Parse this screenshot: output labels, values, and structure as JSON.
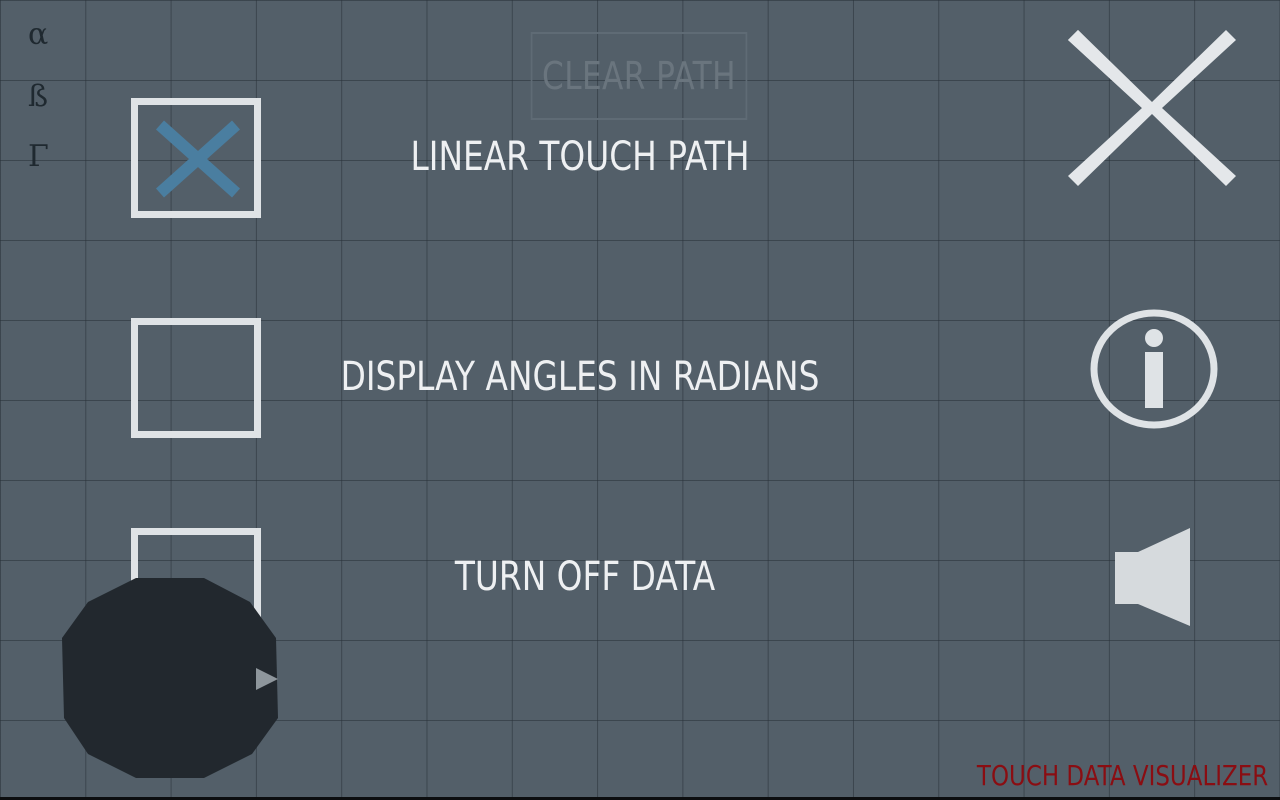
{
  "symbols": {
    "alpha": "α",
    "beta": "ß",
    "gamma": "Γ"
  },
  "clear_path": {
    "label": "CLEAR PATH"
  },
  "options": [
    {
      "label": "LINEAR TOUCH PATH",
      "checked": true
    },
    {
      "label": "DISPLAY ANGLES IN RADIANS",
      "checked": false
    },
    {
      "label": "TURN OFF DATA",
      "checked": false
    }
  ],
  "right_icons": [
    "close-icon",
    "info-icon",
    "speaker-icon"
  ],
  "app_title": "TOUCH DATA VISUALIZER",
  "colors": {
    "background": "#535f69",
    "checkmark": "#4a7ea0",
    "checkbox_border": "#dfe3e6",
    "title": "#8a0d12",
    "joystick": "#22282e"
  }
}
